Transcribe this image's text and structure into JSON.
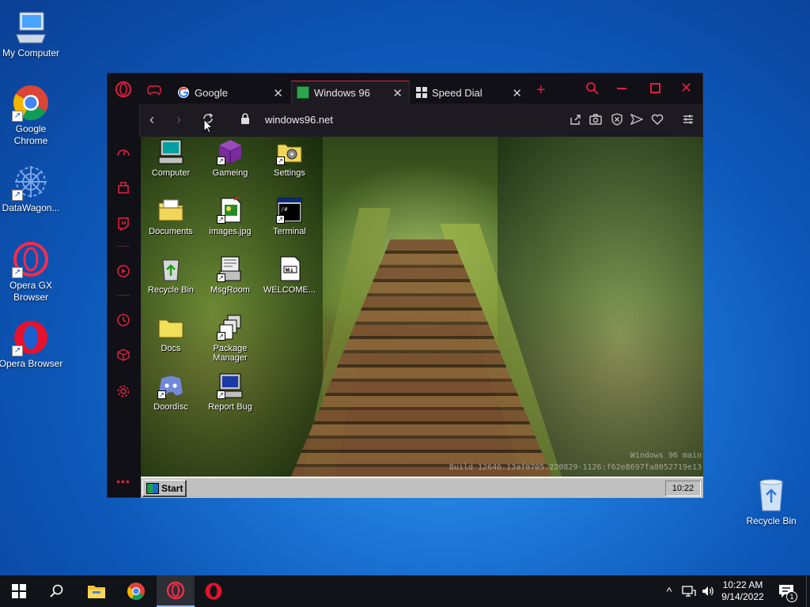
{
  "desktop": {
    "icons": [
      {
        "label": "My Computer",
        "icon": "computer-icon"
      },
      {
        "label": "Google Chrome",
        "icon": "chrome-icon"
      },
      {
        "label": "DataWagon...",
        "icon": "datawagon-icon"
      },
      {
        "label": "Opera GX Browser",
        "icon": "opera-gx-icon"
      },
      {
        "label": "Opera Browser",
        "icon": "opera-icon"
      },
      {
        "label": "Recycle Bin",
        "icon": "recycle-bin-icon"
      }
    ]
  },
  "browser": {
    "tabs": [
      {
        "label": "Google",
        "icon": "google-icon"
      },
      {
        "label": "Windows 96",
        "icon": "windows96-icon"
      },
      {
        "label": "Speed Dial",
        "icon": "speed-dial-icon"
      }
    ],
    "active_tab": "Windows 96",
    "address": "windows96.net",
    "colors": {
      "accent": "#e0203c",
      "background": "#111017",
      "toolbar": "#1d1a22"
    }
  },
  "win96": {
    "icons": [
      {
        "label": "Computer"
      },
      {
        "label": "Gameing"
      },
      {
        "label": "Settings"
      },
      {
        "label": "Documents"
      },
      {
        "label": "images.jpg"
      },
      {
        "label": "Terminal"
      },
      {
        "label": "Recycle Bin"
      },
      {
        "label": "MsgRoom"
      },
      {
        "label": "WELCOME..."
      },
      {
        "label": "Docs"
      },
      {
        "label": "Package Manager"
      },
      {
        "label": "Doordisc"
      },
      {
        "label": "Report Bug"
      }
    ],
    "watermark_line1": "Windows 96 main",
    "watermark_line2": "Build 12646.13af0705.220829-1126:f62e8697fa8052719e13",
    "start_label": "Start",
    "clock": "10:22"
  },
  "taskbar": {
    "time": "10:22 AM",
    "date": "9/14/2022",
    "notification_count": "1"
  }
}
